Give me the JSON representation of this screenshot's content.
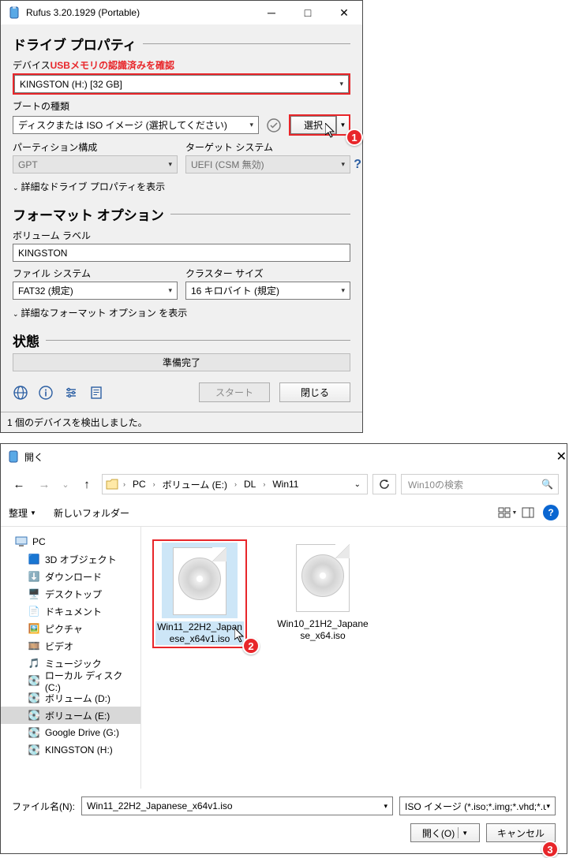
{
  "rufus": {
    "title": "Rufus 3.20.1929 (Portable)",
    "section_drive": "ドライブ プロパティ",
    "device_label": "デバイス",
    "device_hint": "USBメモリの認識済みを確認",
    "device_value": "KINGSTON (H:) [32 GB]",
    "boot_type_label": "ブートの種類",
    "boot_type_value": "ディスクまたは ISO イメージ (選択してください)",
    "select_label": "選択",
    "partition_label": "パーティション構成",
    "partition_value": "GPT",
    "target_label": "ターゲット システム",
    "target_value": "UEFI (CSM 無効)",
    "adv_drive": "詳細なドライブ プロパティを表示",
    "section_format": "フォーマット オプション",
    "volume_label": "ボリューム ラベル",
    "volume_value": "KINGSTON",
    "fs_label": "ファイル システム",
    "fs_value": "FAT32 (規定)",
    "cluster_label": "クラスター サイズ",
    "cluster_value": "16 キロバイト (規定)",
    "adv_format": "詳細なフォーマット オプション を表示",
    "section_status": "状態",
    "status_value": "準備完了",
    "start_btn": "スタート",
    "close_btn": "閉じる",
    "statusbar": "1 個のデバイスを検出しました。"
  },
  "filedlg": {
    "title": "開く",
    "crumbs": [
      "PC",
      "ボリューム (E:)",
      "DL",
      "Win11"
    ],
    "search_placeholder": "Win10の検索",
    "organize": "整理",
    "new_folder": "新しいフォルダー",
    "tree": {
      "root": "PC",
      "items": [
        "3D オブジェクト",
        "ダウンロード",
        "デスクトップ",
        "ドキュメント",
        "ピクチャ",
        "ビデオ",
        "ミュージック",
        "ローカル ディスク (C:)",
        "ボリューム (D:)",
        "ボリューム (E:)",
        "Google Drive (G:)",
        "KINGSTON (H:)"
      ],
      "selected_index": 9
    },
    "files": [
      {
        "name": "Win11_22H2_Japanese_x64v1.iso",
        "selected": true
      },
      {
        "name": "Win10_21H2_Japanese_x64.iso",
        "selected": false
      }
    ],
    "filename_label": "ファイル名(N):",
    "filename_value": "Win11_22H2_Japanese_x64v1.iso",
    "filter_value": "ISO イメージ (*.iso;*.img;*.vhd;*.u",
    "open_btn": "開く(O)",
    "cancel_btn": "キャンセル"
  },
  "badges": {
    "b1": "1",
    "b2": "2",
    "b3": "3"
  }
}
